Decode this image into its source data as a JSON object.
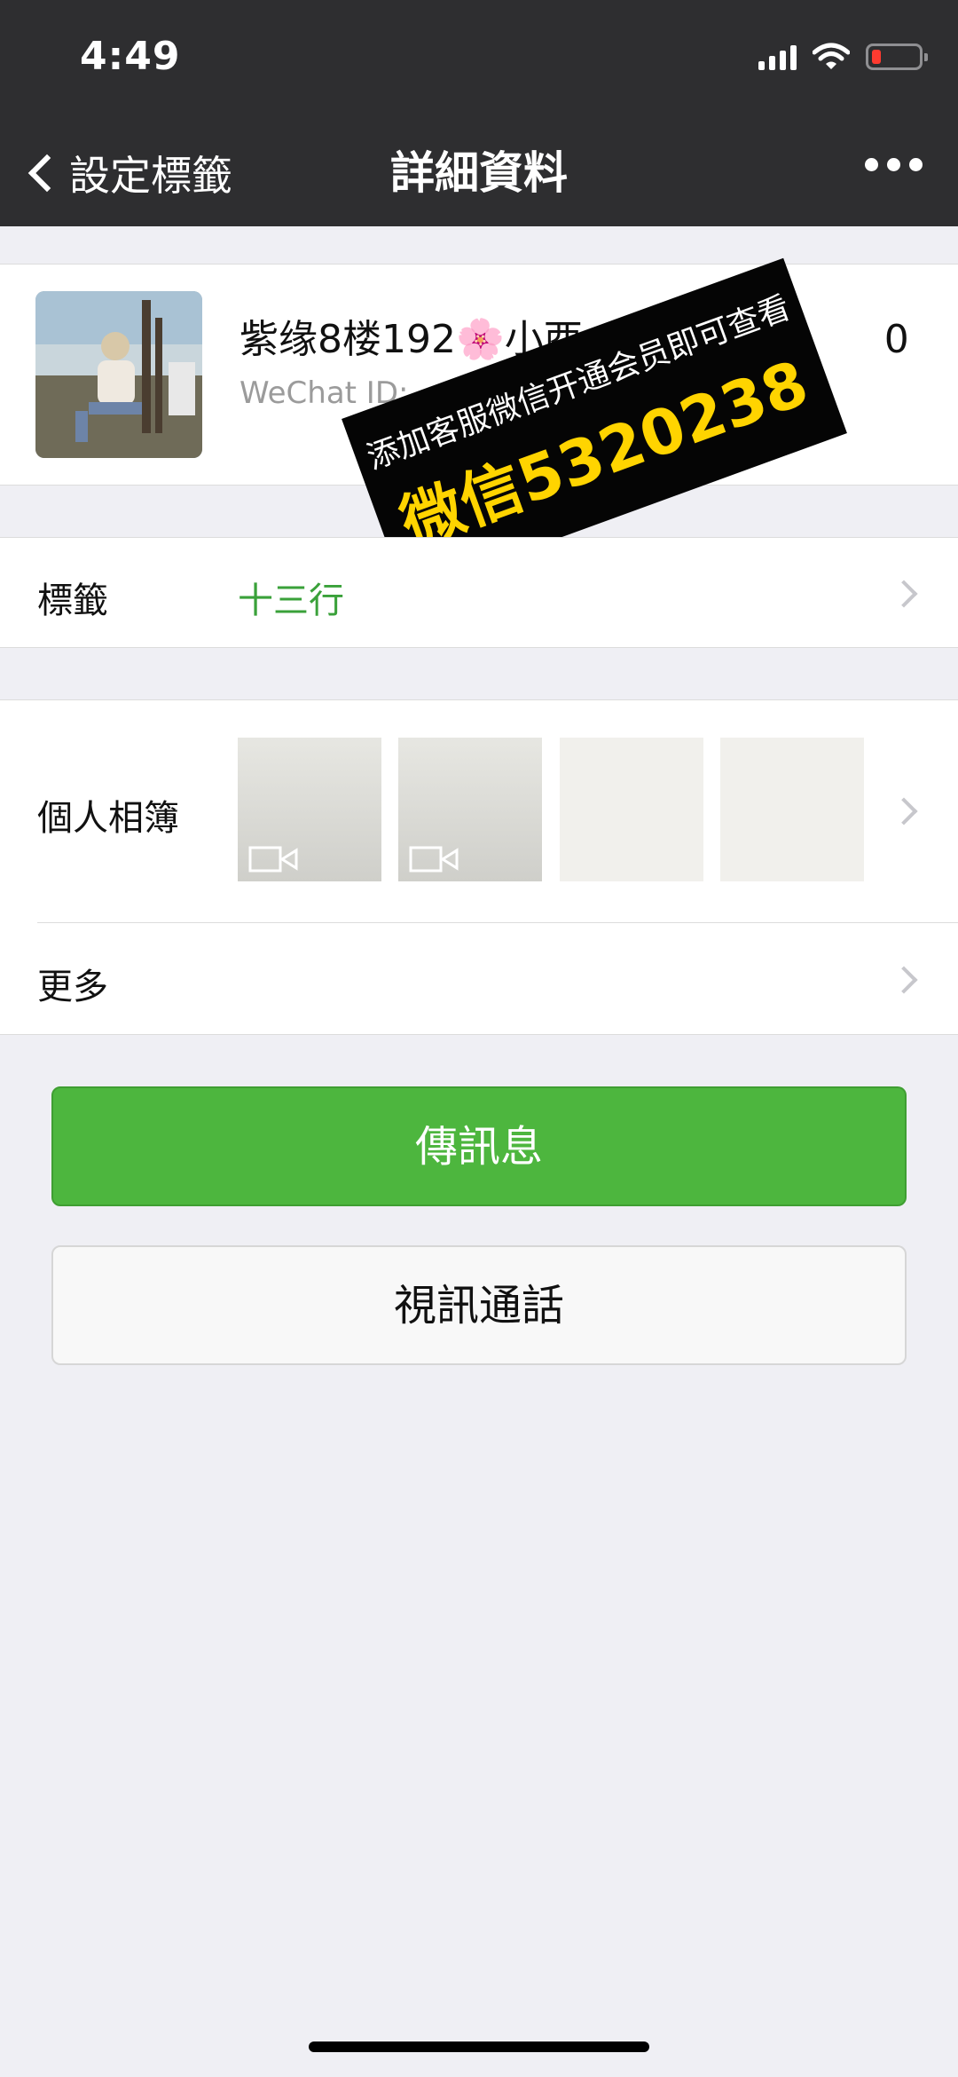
{
  "status_bar": {
    "time": "4:49",
    "icons": [
      "signal-icon",
      "wifi-icon",
      "battery-icon"
    ],
    "battery_color": "#ff3b30"
  },
  "nav": {
    "back_label": "設定標籤",
    "title": "詳細資料",
    "more_icon": "more-icon"
  },
  "profile": {
    "name": "紫缘8楼192🌸小酉",
    "name_tail": "0",
    "wechat_id": "WeChat ID:"
  },
  "promo": {
    "line1": "添加客服微信开通会员即可查看",
    "line2": "微信5320238",
    "bg": "#050505",
    "accent": "#ffd400"
  },
  "tags_row": {
    "label": "標籤",
    "value": "十三行",
    "value_color": "#3aa13a"
  },
  "album_row": {
    "label": "個人相簿",
    "thumbnails": [
      "video",
      "video",
      "photo",
      "photo"
    ]
  },
  "more_row": {
    "label": "更多"
  },
  "buttons": {
    "send": "傳訊息",
    "video_call": "視訊通話",
    "send_color": "#4db63e"
  }
}
